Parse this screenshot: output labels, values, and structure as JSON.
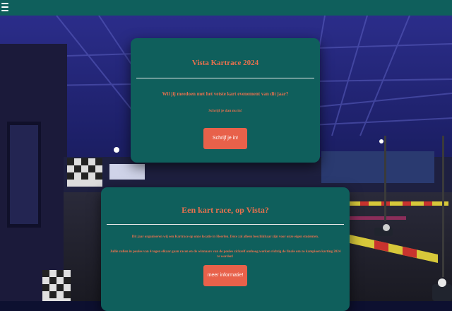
{
  "header": {
    "menu_icon": "hamburger-menu-icon"
  },
  "hero": {
    "title": "Vista Kartrace 2024",
    "question": "Wil jij meedoen met het vetste kart evenement van dit jaar?",
    "subtext": "Schrijf je dan nu in!",
    "button_label": "Schrijf je in!"
  },
  "info": {
    "title": "Een kart race, op Vista?",
    "paragraph1": "Dit jaar organiseren wij een Kartrace op onze locatie in Heerlen. Deze zal alleen beschikbaar zijn voor onze eigen studenten.",
    "paragraph2": "Jullie zullen in poules van 4 tegen elkaar gaan racen en de winnaars van de poules zichzelf omhoog werken richtig de finale om zo kampioen karting 2024 te worden!",
    "button_label": "meer informatie!"
  },
  "colors": {
    "header_bg": "#0f5f5c",
    "card_bg": "#0f5f5c",
    "accent_text": "#e8714e",
    "button_bg": "#e8614a"
  }
}
